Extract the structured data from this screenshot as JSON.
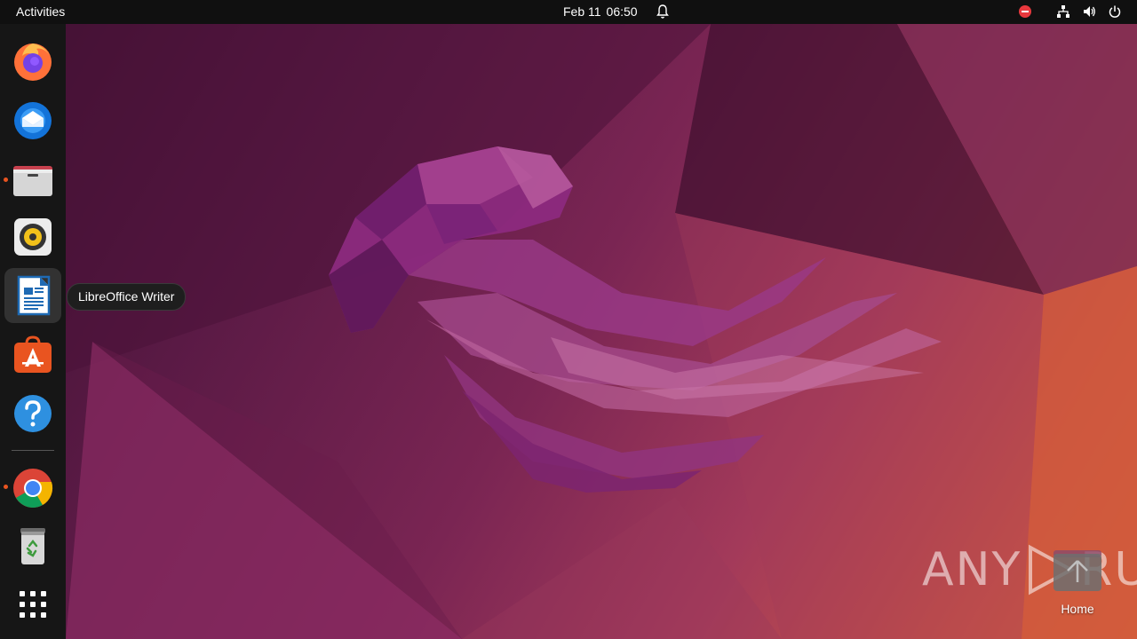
{
  "topbar": {
    "activities_label": "Activities",
    "date": "Feb 11",
    "time": "06:50"
  },
  "dock": {
    "items": [
      {
        "id": "firefox",
        "icon": "firefox-icon",
        "running": false
      },
      {
        "id": "thunderbird",
        "icon": "thunderbird-icon",
        "running": false
      },
      {
        "id": "files",
        "icon": "files-icon",
        "running": true
      },
      {
        "id": "rhythmbox",
        "icon": "rhythmbox-icon",
        "running": false
      },
      {
        "id": "libreoffice-writer",
        "icon": "libreoffice-writer-icon",
        "running": false,
        "hovered": true
      },
      {
        "id": "software",
        "icon": "ubuntu-software-icon",
        "running": false
      },
      {
        "id": "help",
        "icon": "help-icon",
        "running": false
      },
      {
        "id": "chrome",
        "icon": "chrome-icon",
        "running": true
      },
      {
        "id": "trash",
        "icon": "trash-icon",
        "running": false
      },
      {
        "id": "apps-grid",
        "icon": "apps-grid-icon",
        "running": false
      }
    ]
  },
  "tooltip": {
    "label": "LibreOffice Writer"
  },
  "desktop": {
    "home_label": "Home"
  },
  "watermark": {
    "left": "ANY",
    "right": "RUN"
  },
  "colors": {
    "accent": "#e95420",
    "topbar": "#101010",
    "dock": "#161616"
  }
}
